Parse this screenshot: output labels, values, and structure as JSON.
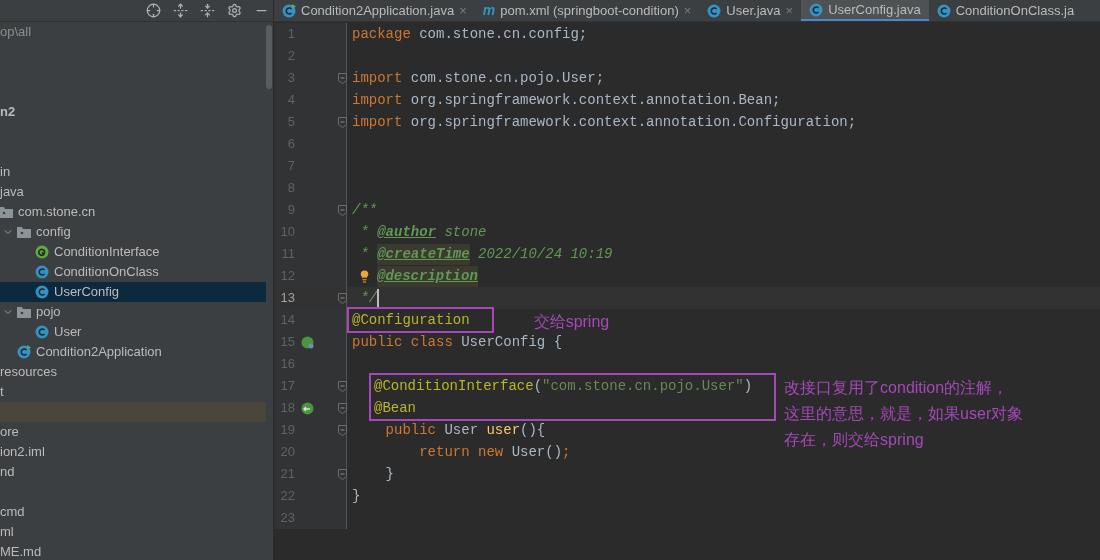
{
  "project_panel": {
    "toolbar": [
      {
        "kind": "locate"
      },
      {
        "kind": "expand"
      },
      {
        "kind": "collapse"
      },
      {
        "kind": "settings"
      },
      {
        "kind": "hide"
      }
    ],
    "tree": [
      {
        "kind": "path",
        "label": "op\\all",
        "selected": false
      },
      {
        "kind": "blank"
      },
      {
        "kind": "blank"
      },
      {
        "kind": "blank"
      },
      {
        "kind": "module",
        "label": "n2",
        "selected": false
      },
      {
        "kind": "blank"
      },
      {
        "kind": "blank"
      },
      {
        "kind": "plain",
        "label": "in",
        "selected": false
      },
      {
        "kind": "plain",
        "label": "java",
        "selected": false,
        "children": [
          {
            "kind": "package",
            "label": "com.stone.cn",
            "selected": false,
            "children": [
              {
                "kind": "package",
                "label": "config",
                "expanded": true,
                "selected": false,
                "children": [
                  {
                    "kind": "annotation",
                    "label": "ConditionInterface",
                    "selected": false
                  },
                  {
                    "kind": "class",
                    "label": "ConditionOnClass",
                    "selected": false
                  },
                  {
                    "kind": "class",
                    "label": "UserConfig",
                    "selected": true
                  }
                ]
              },
              {
                "kind": "package",
                "label": "pojo",
                "expanded": true,
                "selected": false,
                "children": [
                  {
                    "kind": "class",
                    "label": "User",
                    "selected": false
                  }
                ]
              },
              {
                "kind": "app",
                "label": "Condition2Application",
                "selected": false
              }
            ]
          }
        ]
      },
      {
        "kind": "plain",
        "label": "resources",
        "selected": false
      },
      {
        "kind": "plain",
        "label": "t",
        "selected": false
      },
      {
        "kind": "highlighted_blank"
      },
      {
        "kind": "plain",
        "label": "ore",
        "selected": false
      },
      {
        "kind": "plain",
        "label": "ion2.iml",
        "selected": false
      },
      {
        "kind": "plain",
        "label": "nd",
        "selected": false
      },
      {
        "kind": "blank"
      },
      {
        "kind": "plain",
        "label": "cmd",
        "selected": false
      },
      {
        "kind": "plain",
        "label": "ml",
        "selected": false
      },
      {
        "kind": "plain",
        "label": "ME.md",
        "selected": false
      }
    ]
  },
  "tabs": [
    {
      "kind": "app",
      "label": "Condition2Application.java",
      "selected": false,
      "close": "×"
    },
    {
      "kind": "maven",
      "icon": "m",
      "label": "pom.xml (springboot-condition)",
      "selected": false,
      "close": "×"
    },
    {
      "kind": "class",
      "label": "User.java",
      "selected": false,
      "close": "×"
    },
    {
      "kind": "class",
      "label": "UserConfig.java",
      "selected": true
    },
    {
      "kind": "class",
      "label": "ConditionOnClass.ja",
      "selected": false
    }
  ],
  "editor": [
    {
      "kind": "line",
      "number": "1",
      "current": false,
      "tokens": [
        {
          "kind": "kw",
          "text": "package "
        },
        {
          "kind": "plain",
          "text": "com.stone.cn.config;"
        }
      ]
    },
    {
      "kind": "line",
      "number": "2",
      "current": false
    },
    {
      "kind": "line",
      "number": "3",
      "current": false,
      "fold": true,
      "tokens": [
        {
          "kind": "kw",
          "text": "import "
        },
        {
          "kind": "plain",
          "text": "com.stone.cn.pojo.User;"
        }
      ]
    },
    {
      "kind": "line",
      "number": "4",
      "current": false,
      "tokens": [
        {
          "kind": "kw",
          "text": "import "
        },
        {
          "kind": "plain",
          "text": "org.springframework.context.annotation.Bean;"
        }
      ]
    },
    {
      "kind": "line",
      "number": "5",
      "current": false,
      "fold": true,
      "tokens": [
        {
          "kind": "kw",
          "text": "import "
        },
        {
          "kind": "plain",
          "text": "org.springframework.context.annotation.Configuration;"
        }
      ]
    },
    {
      "kind": "line",
      "number": "6",
      "current": false
    },
    {
      "kind": "line",
      "number": "7",
      "current": false
    },
    {
      "kind": "line",
      "number": "8",
      "current": false
    },
    {
      "kind": "line",
      "number": "9",
      "current": false,
      "fold": true,
      "tokens": [
        {
          "kind": "cmt",
          "text": "/**"
        }
      ]
    },
    {
      "kind": "line",
      "number": "10",
      "current": false,
      "tokens": [
        {
          "kind": "cmt",
          "text": " * "
        },
        {
          "kind": "tag",
          "text": "@author"
        },
        {
          "kind": "cmt",
          "text": " stone"
        }
      ]
    },
    {
      "kind": "line",
      "number": "11",
      "current": false,
      "tokens": [
        {
          "kind": "cmt",
          "text": " * "
        },
        {
          "kind": "tag_hl",
          "text": "@createTime"
        },
        {
          "kind": "cmt",
          "text": " 2022/10/24 10:19"
        }
      ]
    },
    {
      "kind": "line",
      "number": "12",
      "current": false,
      "tokens": [
        {
          "kind": "bulb"
        },
        {
          "kind": "tag_hl",
          "text": "@description"
        }
      ]
    },
    {
      "kind": "line",
      "number": "13",
      "current": true,
      "fold": true,
      "tokens": [
        {
          "kind": "cmt",
          "text": " */"
        },
        {
          "kind": "caret"
        }
      ]
    },
    {
      "kind": "callout",
      "note": [
        "交给spring"
      ],
      "lines": [
        {
          "kind": "line",
          "number": "14",
          "current": false,
          "tokens": [
            {
              "kind": "ann",
              "text": "@Configuration"
            }
          ]
        }
      ]
    },
    {
      "kind": "line",
      "number": "15",
      "current": false,
      "gutter": {
        "kind": "bean"
      },
      "tokens": [
        {
          "kind": "kw",
          "text": "public class "
        },
        {
          "kind": "plain",
          "text": "UserConfig {"
        }
      ]
    },
    {
      "kind": "line",
      "number": "16",
      "current": false
    },
    {
      "kind": "callout",
      "note": [
        "改接口复用了condition的注解，",
        "这里的意思，就是，如果user对象",
        "存在，则交给spring"
      ],
      "lines": [
        {
          "kind": "line",
          "number": "17",
          "current": false,
          "fold": true,
          "tokens": [
            {
              "kind": "ann",
              "text": "@ConditionInterface"
            },
            {
              "kind": "plain",
              "text": "("
            },
            {
              "kind": "str",
              "text": "\"com.stone.cn.pojo.User\""
            },
            {
              "kind": "plain",
              "text": ")"
            }
          ]
        },
        {
          "kind": "line",
          "number": "18",
          "current": false,
          "fold": true,
          "gutter": {
            "kind": "bean_link"
          },
          "tokens": [
            {
              "kind": "ann",
              "text": "@Bean"
            }
          ]
        }
      ]
    },
    {
      "kind": "line",
      "number": "19",
      "current": false,
      "fold": true,
      "tokens": [
        {
          "kind": "kw",
          "text": "    public "
        },
        {
          "kind": "plain",
          "text": "User "
        },
        {
          "kind": "fn",
          "text": "user"
        },
        {
          "kind": "plain",
          "text": "(){"
        }
      ]
    },
    {
      "kind": "line",
      "number": "20",
      "current": false,
      "tokens": [
        {
          "kind": "kw",
          "text": "        return new "
        },
        {
          "kind": "plain",
          "text": "User()"
        },
        {
          "kind": "kw",
          "text": ";"
        }
      ]
    },
    {
      "kind": "line",
      "number": "21",
      "current": false,
      "fold": true,
      "tokens": [
        {
          "kind": "plain",
          "text": "    }"
        }
      ]
    },
    {
      "kind": "line",
      "number": "22",
      "current": false,
      "tokens": [
        {
          "kind": "plain",
          "text": "}"
        }
      ]
    },
    {
      "kind": "line",
      "number": "23",
      "current": false
    }
  ]
}
